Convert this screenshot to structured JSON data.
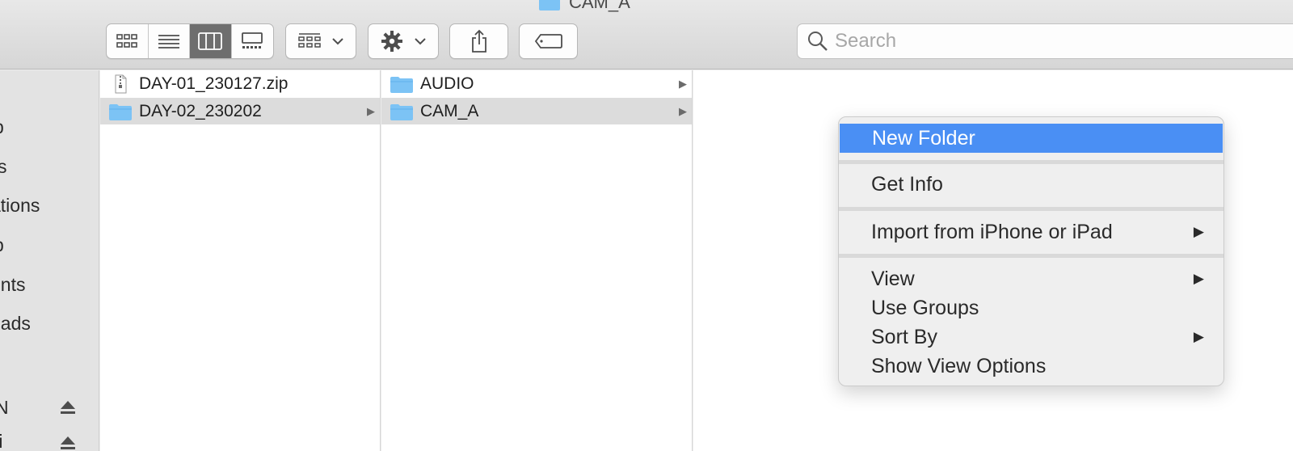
{
  "window": {
    "title": "CAM_A"
  },
  "toolbar": {
    "view_modes": [
      "icon-view",
      "list-view",
      "column-view",
      "gallery-view"
    ],
    "active_view": "column-view",
    "search_placeholder": "Search"
  },
  "sidebar": {
    "items": [
      "p",
      "s",
      "ations",
      "p",
      "ents",
      "oads",
      "N",
      "ti"
    ]
  },
  "columns": [
    {
      "rows": [
        {
          "name": "DAY-01_230127.zip",
          "type": "zip",
          "selected": false,
          "has_children": false
        },
        {
          "name": "DAY-02_230202",
          "type": "folder",
          "selected": true,
          "has_children": true
        }
      ]
    },
    {
      "rows": [
        {
          "name": "AUDIO",
          "type": "folder",
          "selected": false,
          "has_children": true
        },
        {
          "name": "CAM_A",
          "type": "folder",
          "selected": true,
          "has_children": true
        }
      ]
    }
  ],
  "context_menu": {
    "new_folder": "New Folder",
    "get_info": "Get Info",
    "import": "Import from iPhone or iPad",
    "view": "View",
    "use_groups": "Use Groups",
    "sort_by": "Sort By",
    "show_view_options": "Show View Options",
    "submenu_glyph": "▶"
  },
  "colors": {
    "highlight": "#4a8ff4",
    "folder": "#7cc3f5",
    "selection": "#dcdcdc"
  }
}
